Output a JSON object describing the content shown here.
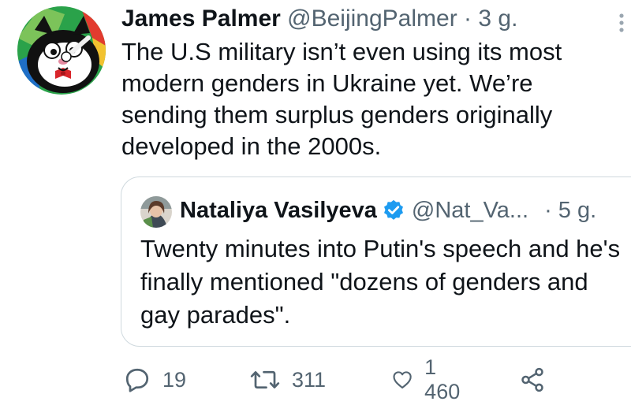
{
  "tweet": {
    "author_name": "James Palmer",
    "author_handle": "@BeijingPalmer",
    "separator": "·",
    "time": "3 g.",
    "text": "The U.S military isn’t even using its most modern genders in Ukraine yet. We’re sending them surplus genders originally developed in the 2000s.",
    "more_icon": "vertical-ellipsis-icon",
    "avatar_icon": "cartoon-cat-avatar"
  },
  "quoted_tweet": {
    "author_name": "Nataliya Vasilyeva",
    "verified_icon": "verified-badge-icon",
    "author_handle": "@Nat_Va...",
    "separator": "·",
    "time": "5 g.",
    "text": "Twenty minutes into Putin's speech and he's finally mentioned \"dozens of genders and gay parades\"."
  },
  "actions": {
    "reply": {
      "icon": "reply-icon",
      "count": "19"
    },
    "retweet": {
      "icon": "retweet-icon",
      "count": "311"
    },
    "like": {
      "icon": "heart-icon",
      "count": "1 460"
    },
    "share": {
      "icon": "share-icon"
    }
  },
  "colors": {
    "text": "#0f1419",
    "muted": "#536471",
    "border": "#cfd9de",
    "verified": "#1d9bf0",
    "avatar_bg": "#27a24a"
  }
}
